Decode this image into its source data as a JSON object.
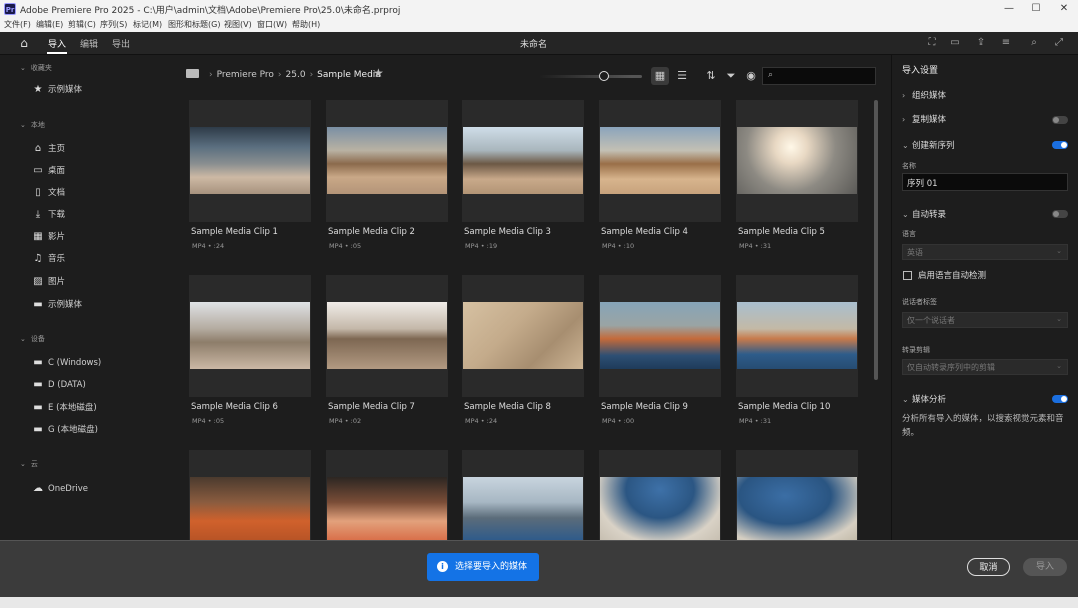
{
  "window": {
    "title": "Adobe Premiere Pro 2025 - C:\\用户\\admin\\文档\\Adobe\\Premiere Pro\\25.0\\未命名.prproj",
    "logo": "Pr",
    "minimize": "—",
    "restore": "☐",
    "close": "✕"
  },
  "menu": [
    "文件(F)",
    "编辑(E)",
    "剪辑(C)",
    "序列(S)",
    "标记(M)",
    "图形和标题(G)",
    "视图(V)",
    "窗口(W)",
    "帮助(H)"
  ],
  "appbar": {
    "tabs": [
      "导入",
      "编辑",
      "导出"
    ],
    "active_tab": "导入",
    "title": "未命名"
  },
  "sidebar": {
    "sections": [
      {
        "label": "收藏夹",
        "items": [
          {
            "label": "示例媒体",
            "icon": "star-icon",
            "glyph": "★"
          }
        ]
      },
      {
        "label": "本地",
        "items": [
          {
            "label": "主页",
            "icon": "home-icon",
            "glyph": "⌂"
          },
          {
            "label": "桌面",
            "icon": "desktop-icon",
            "glyph": "▭"
          },
          {
            "label": "文档",
            "icon": "document-icon",
            "glyph": "▯"
          },
          {
            "label": "下载",
            "icon": "download-icon",
            "glyph": "⤓"
          },
          {
            "label": "影片",
            "icon": "film-icon",
            "glyph": "▦"
          },
          {
            "label": "音乐",
            "icon": "music-icon",
            "glyph": "♫"
          },
          {
            "label": "图片",
            "icon": "image-icon",
            "glyph": "▨"
          },
          {
            "label": "示例媒体",
            "icon": "folder-icon",
            "glyph": "▬"
          }
        ]
      },
      {
        "label": "设备",
        "items": [
          {
            "label": "C (Windows)",
            "icon": "folder-icon",
            "glyph": "▬"
          },
          {
            "label": "D (DATA)",
            "icon": "folder-icon",
            "glyph": "▬"
          },
          {
            "label": "E (本地磁盘)",
            "icon": "folder-icon",
            "glyph": "▬"
          },
          {
            "label": "G (本地磁盘)",
            "icon": "folder-icon",
            "glyph": "▬"
          }
        ]
      },
      {
        "label": "云",
        "items": [
          {
            "label": "OneDrive",
            "icon": "cloud-icon",
            "glyph": "☁"
          }
        ]
      }
    ]
  },
  "browser": {
    "breadcrumb": [
      "Premiere Pro",
      "25.0",
      "Sample Media"
    ],
    "search_placeholder": "",
    "clips": [
      {
        "name": "Sample Media Clip 1",
        "meta": "MP4 • :24"
      },
      {
        "name": "Sample Media Clip 2",
        "meta": "MP4 • :05"
      },
      {
        "name": "Sample Media Clip 3",
        "meta": "MP4 • :19"
      },
      {
        "name": "Sample Media Clip 4",
        "meta": "MP4 • :10"
      },
      {
        "name": "Sample Media Clip 5",
        "meta": "MP4 • :31"
      },
      {
        "name": "Sample Media Clip 6",
        "meta": "MP4 • :05"
      },
      {
        "name": "Sample Media Clip 7",
        "meta": "MP4 • :02"
      },
      {
        "name": "Sample Media Clip 8",
        "meta": "MP4 • :24"
      },
      {
        "name": "Sample Media Clip 9",
        "meta": "MP4 • :00"
      },
      {
        "name": "Sample Media Clip 10",
        "meta": "MP4 • :31"
      },
      {
        "name": "",
        "meta": ""
      },
      {
        "name": "",
        "meta": ""
      },
      {
        "name": "",
        "meta": ""
      },
      {
        "name": "",
        "meta": ""
      },
      {
        "name": "",
        "meta": ""
      }
    ]
  },
  "import_settings": {
    "title": "导入设置",
    "organize_media": "组织媒体",
    "copy_media": "复制媒体",
    "copy_media_on": false,
    "new_sequence": "创建新序列",
    "new_sequence_on": true,
    "name_label": "名称",
    "name_value": "序列 01",
    "auto_transcribe": "自动转录",
    "auto_transcribe_on": false,
    "language_label": "语言",
    "language_value": "英语",
    "auto_detect_language": "启用语言自动检测",
    "speaker_label": "说话者标签",
    "speaker_value": "仅一个说话者",
    "transcribe_label": "转录剪辑",
    "transcribe_value": "仅自动转录序列中的剪辑",
    "media_analysis": "媒体分析",
    "media_analysis_on": true,
    "media_analysis_desc": "分析所有导入的媒体，以搜索视觉元素和音频。"
  },
  "footer": {
    "alert": "选择要导入的媒体",
    "cancel": "取消",
    "import": "导入"
  }
}
